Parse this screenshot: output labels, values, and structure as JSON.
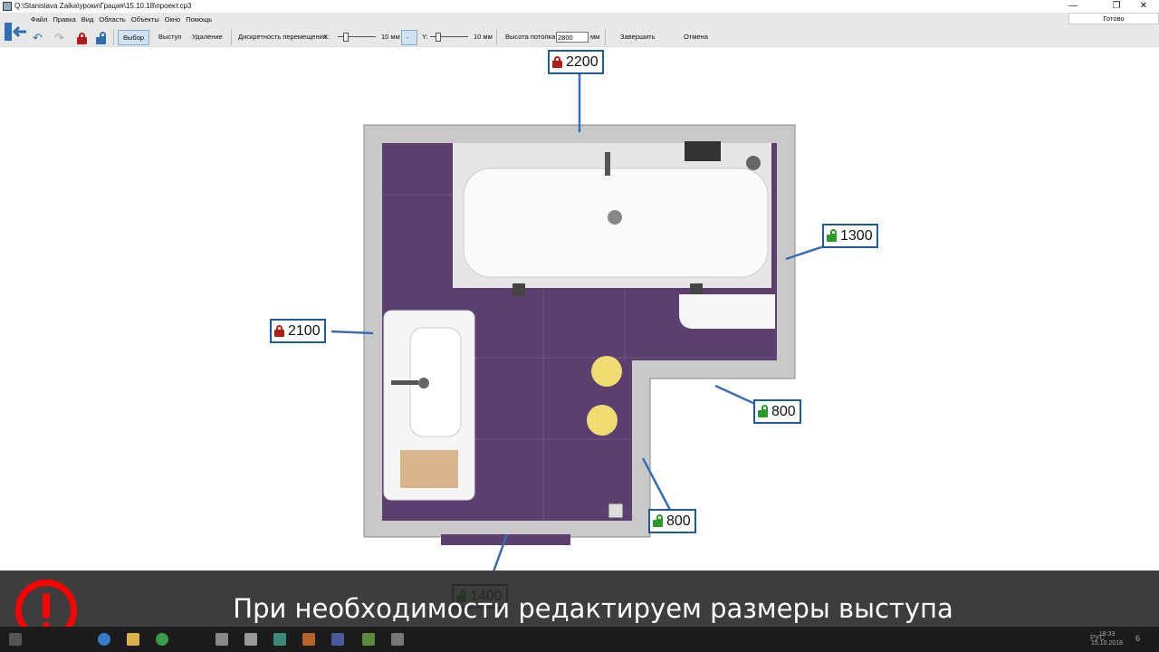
{
  "window": {
    "title": "Q:\\Stanislava Zaika\\уроки\\Грация\\15.10.18\\проект.cp3",
    "minimize": "—",
    "restore": "❐",
    "close": "✕"
  },
  "menu": [
    "Файл",
    "Правка",
    "Вид",
    "Область",
    "Объекты",
    "Окно",
    "Помощь"
  ],
  "toolbar": {
    "select": "Выбор",
    "protrusion": "Выступ",
    "delete": "Удаление",
    "step_label": "Дискретность перемещения",
    "x_label": "X:",
    "x_value": "10 мм",
    "toggle": "-",
    "y_label": "Y:",
    "y_value": "10 мм",
    "ceiling_label": "Высота потолка",
    "ceiling_value": "2800",
    "ceiling_unit": "мм",
    "finish": "Завершить",
    "cancel": "Отмена",
    "status": "Готово"
  },
  "dimensions": [
    {
      "value": "2200",
      "locked": true
    },
    {
      "value": "1300",
      "locked": false
    },
    {
      "value": "2100",
      "locked": true
    },
    {
      "value": "800",
      "locked": false
    },
    {
      "value": "800",
      "locked": false
    },
    {
      "value": "1400",
      "locked": false
    }
  ],
  "colors": {
    "floor": "#5b3f6f",
    "wall": "#c8c8c8",
    "dim_border": "#1f5a99",
    "locked": "#b31b1b",
    "unlocked": "#2a9b2a"
  },
  "caption": "При необходимости редактируем размеры выступа",
  "tray": {
    "lang": "РУС",
    "time": "18:33",
    "date": "15.10.2018",
    "notifications": "6"
  }
}
